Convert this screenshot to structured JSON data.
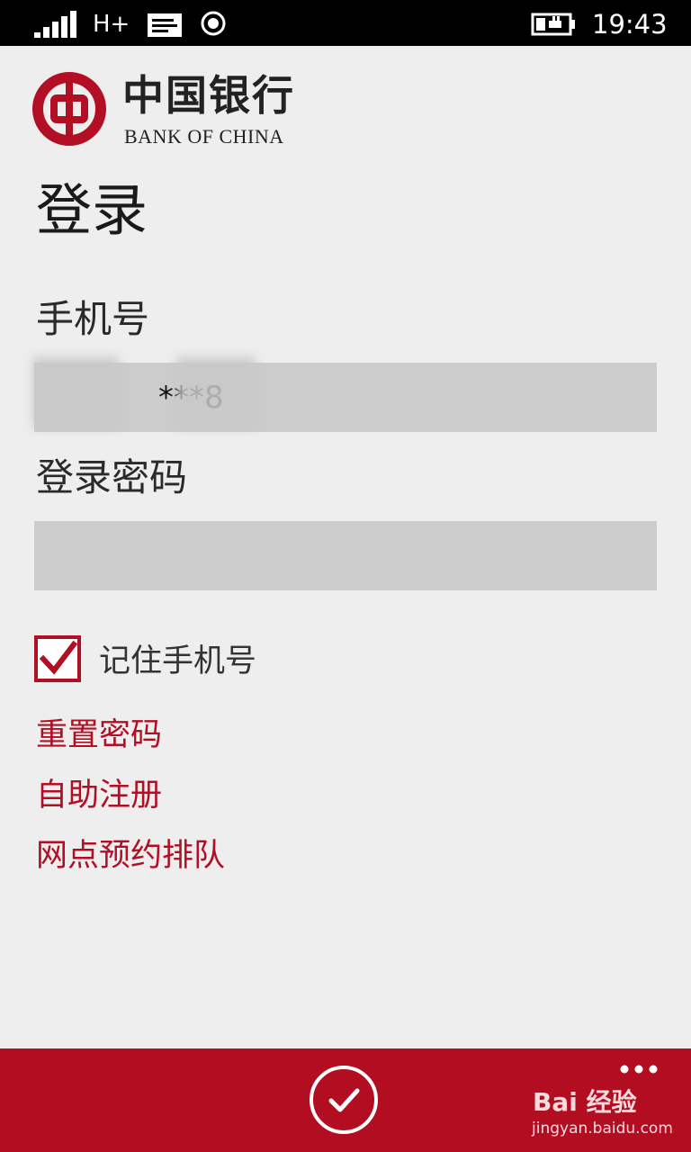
{
  "status_bar": {
    "network": "H+",
    "time": "19:43",
    "icons": [
      "signal-icon",
      "message-icon",
      "location-icon",
      "battery-charging-icon"
    ]
  },
  "logo": {
    "chinese_name": "中国银行",
    "english_name": "BANK OF CHINA",
    "brand_color": "#b20e24"
  },
  "page": {
    "title": "登录"
  },
  "form": {
    "phone_label": "手机号",
    "phone_value": "***8",
    "password_label": "登录密码",
    "password_value": "",
    "remember_label": "记住手机号",
    "remember_checked": true
  },
  "links": {
    "reset_password": "重置密码",
    "self_register": "自助注册",
    "branch_queue": "网点预约排队"
  },
  "app_bar": {
    "background": "#b30d22",
    "confirm_icon": "check-circle-icon",
    "more_icon": "more-dots-icon"
  },
  "watermark": {
    "brand": "Bai 经验",
    "url": "jingyan.baidu.com"
  }
}
